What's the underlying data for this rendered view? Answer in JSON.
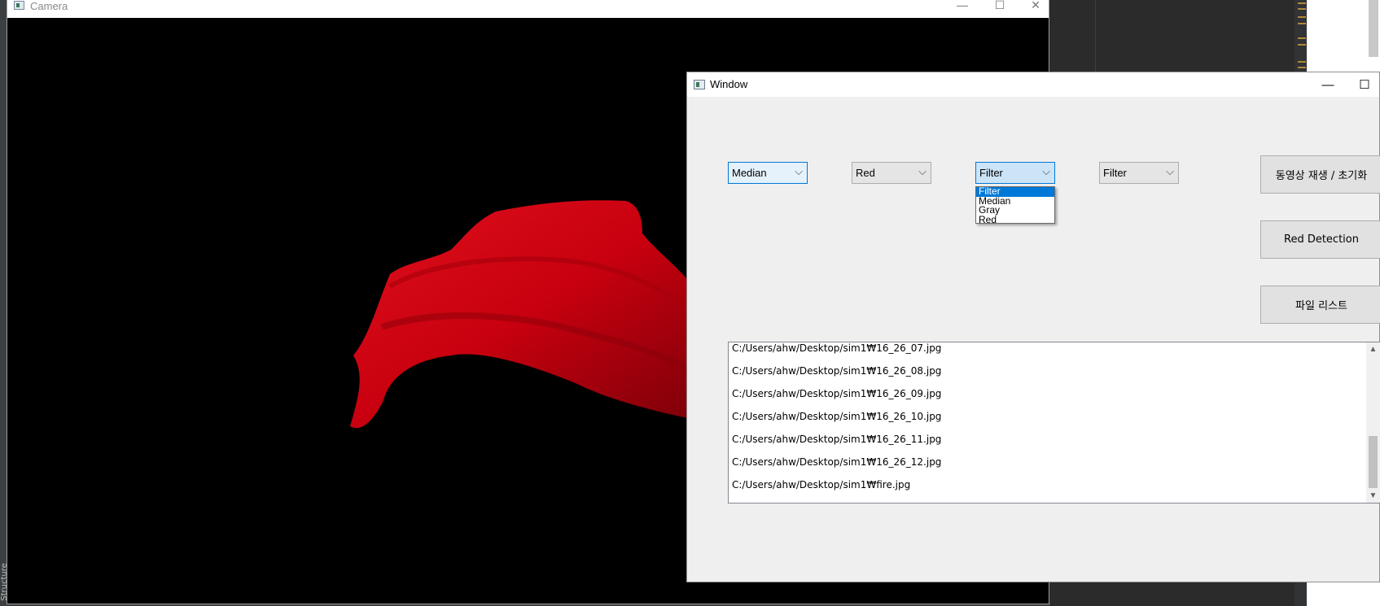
{
  "camera_window": {
    "title": "Camera",
    "controls": {
      "minimize": "—",
      "maximize": "☐",
      "close": "✕"
    }
  },
  "main_window": {
    "title": "Window",
    "controls": {
      "minimize": "—",
      "maximize": "☐"
    },
    "combos": [
      {
        "value": "Median"
      },
      {
        "value": "Red"
      },
      {
        "value": "Filter"
      },
      {
        "value": "Filter"
      }
    ],
    "chevron": "⌵",
    "dropdown": {
      "options": [
        "Filter",
        "Median",
        "Gray",
        "Red"
      ],
      "selected": "Filter"
    },
    "buttons": {
      "play_reset": "동영상 재생 / 초기화",
      "red_detection": "Red Detection",
      "file_list": "파일 리스트"
    },
    "file_list": [
      "C:/Users/ahw/Desktop/sim1₩16_26_07.jpg",
      "C:/Users/ahw/Desktop/sim1₩16_26_08.jpg",
      "C:/Users/ahw/Desktop/sim1₩16_26_09.jpg",
      "C:/Users/ahw/Desktop/sim1₩16_26_10.jpg",
      "C:/Users/ahw/Desktop/sim1₩16_26_11.jpg",
      "C:/Users/ahw/Desktop/sim1₩16_26_12.jpg",
      "C:/Users/ahw/Desktop/sim1₩fire.jpg"
    ],
    "scrollbar": {
      "up": "▲",
      "down": "▼"
    }
  },
  "side_panel": {
    "vertical_text": "Structure"
  },
  "colors": {
    "accent": "#0078d7",
    "ide_background": "#2b2b2b",
    "cloth_red": "#c8000f"
  }
}
